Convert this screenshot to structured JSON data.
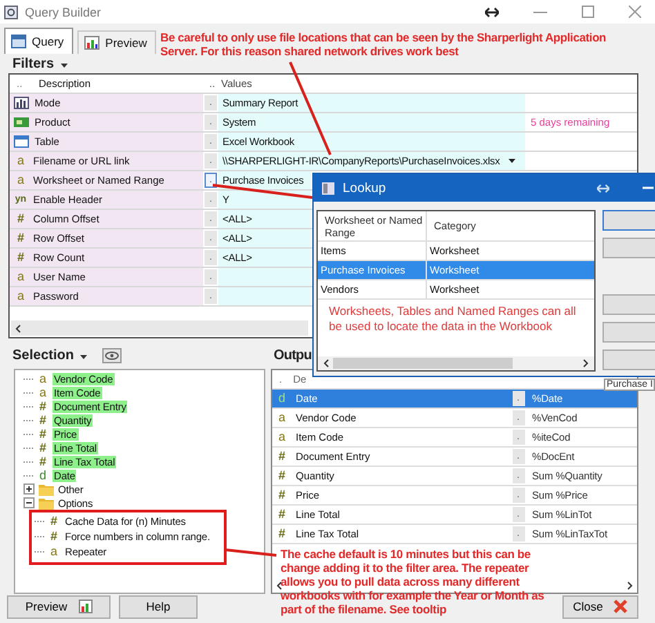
{
  "window": {
    "title": "Query Builder"
  },
  "tabs": [
    {
      "label": "Query",
      "selected": true
    },
    {
      "label": "Preview",
      "selected": false
    }
  ],
  "filters": {
    "title": "Filters",
    "columns": [
      "..",
      "Description",
      "..",
      "Values"
    ],
    "rows": [
      {
        "kind": "mode",
        "description": "Mode",
        "button": ".",
        "value": "Summary Report",
        "focused": false
      },
      {
        "kind": "product",
        "description": "Product",
        "button": ".",
        "value": "System",
        "note": "5 days remaining",
        "focused": false
      },
      {
        "kind": "table",
        "description": "Table",
        "button": ".",
        "value": "Excel Workbook",
        "focused": false
      },
      {
        "kind": "field",
        "glyph": "a",
        "description": "Filename or URL link",
        "button": ".",
        "value": "\\\\SHARPERLIGHT-IR\\CompanyReports\\PurchaseInvoices.xlsx",
        "dropdown": true,
        "focused": false
      },
      {
        "kind": "field",
        "glyph": "a",
        "description": "Worksheet or Named Range",
        "button": ".",
        "value": "Purchase Invoices",
        "focused": true
      },
      {
        "kind": "field",
        "glyph": "yn",
        "description": "Enable Header",
        "button": ".",
        "value": "Y",
        "focused": false
      },
      {
        "kind": "field",
        "glyph": "#",
        "description": "Column Offset",
        "button": ".",
        "value": "<ALL>",
        "focused": false
      },
      {
        "kind": "field",
        "glyph": "#",
        "description": "Row Offset",
        "button": ".",
        "value": "<ALL>",
        "focused": false
      },
      {
        "kind": "field",
        "glyph": "#",
        "description": "Row Count",
        "button": ".",
        "value": "<ALL>",
        "focused": false
      },
      {
        "kind": "field",
        "glyph": "a",
        "description": "User Name",
        "button": ".",
        "focused": false
      },
      {
        "kind": "field",
        "glyph": "a",
        "description": "Password",
        "button": ".",
        "focused": false
      }
    ],
    "partial_text": "Purchase I"
  },
  "lookup": {
    "title": "Lookup",
    "columns": [
      "Worksheet or Named Range",
      "Category"
    ],
    "rows": [
      {
        "name": "Items",
        "category": "Worksheet",
        "selected": false
      },
      {
        "name": "Purchase Invoices",
        "category": "Worksheet",
        "selected": true
      },
      {
        "name": "Vendors",
        "category": "Worksheet",
        "selected": false
      }
    ],
    "note": "Worksheets, Tables and Named Ranges can all be used to locate the data in the Workbook"
  },
  "selection": {
    "title": "Selection",
    "tree": [
      {
        "kind": "field",
        "glyph": "a",
        "label": "Vendor Code",
        "highlighted": true
      },
      {
        "kind": "field",
        "glyph": "a",
        "label": "Item Code",
        "highlighted": true
      },
      {
        "kind": "field",
        "glyph": "#",
        "label": "Document Entry",
        "highlighted": true
      },
      {
        "kind": "field",
        "glyph": "#",
        "label": "Quantity",
        "highlighted": true
      },
      {
        "kind": "field",
        "glyph": "#",
        "label": "Price",
        "highlighted": true
      },
      {
        "kind": "field",
        "glyph": "#",
        "label": "Line Total",
        "highlighted": true
      },
      {
        "kind": "field",
        "glyph": "#",
        "label": "Line Tax Total",
        "highlighted": true
      },
      {
        "kind": "field",
        "glyph": "d",
        "label": "Date",
        "highlighted": true
      },
      {
        "kind": "folder",
        "label": "Other",
        "expanded": false
      },
      {
        "kind": "folder",
        "label": "Options",
        "expanded": true,
        "children": [
          {
            "kind": "field",
            "glyph": "#",
            "label": "Cache Data for (n) Minutes",
            "highlighted": false
          },
          {
            "kind": "field",
            "glyph": "#",
            "label": "Force numbers in column range.",
            "highlighted": false
          },
          {
            "kind": "field",
            "glyph": "a",
            "label": "Repeater",
            "highlighted": false
          }
        ]
      }
    ]
  },
  "output": {
    "title": "Outpu",
    "columns": [
      ".",
      "De"
    ],
    "rows": [
      {
        "glyph": "d",
        "description": "Date",
        "button": ".",
        "formula": "%Date",
        "selected": true
      },
      {
        "glyph": "a",
        "description": "Vendor Code",
        "button": ".",
        "formula": "%VenCod",
        "selected": false
      },
      {
        "glyph": "a",
        "description": "Item Code",
        "button": ".",
        "formula": "%iteCod",
        "selected": false
      },
      {
        "glyph": "#",
        "description": "Document Entry",
        "button": ".",
        "formula": "%DocEnt",
        "selected": false
      },
      {
        "glyph": "#",
        "description": "Quantity",
        "button": ".",
        "formula": "Sum %Quantity",
        "selected": false
      },
      {
        "glyph": "#",
        "description": "Price",
        "button": ".",
        "formula": "Sum %Price",
        "selected": false
      },
      {
        "glyph": "#",
        "description": "Line Total",
        "button": ".",
        "formula": "Sum %LinTot",
        "selected": false
      },
      {
        "glyph": "#",
        "description": "Line Tax Total",
        "button": ".",
        "formula": "Sum %LinTaxTot",
        "selected": false
      }
    ]
  },
  "annotations": [
    {
      "text": "Be careful to only use file locations that can be seen by the Sharperlight Application Server. For this reason shared network drives work best"
    },
    {
      "text": "The cache default is 10 minutes but this can be change adding it to the filter area.  The repeater allows you to pull data across many different workbooks with for example the Year or Month as part of the filename.  See tooltip"
    }
  ],
  "buttons": [
    {
      "label": "Preview"
    },
    {
      "label": "Help"
    },
    {
      "label": "Close"
    }
  ]
}
